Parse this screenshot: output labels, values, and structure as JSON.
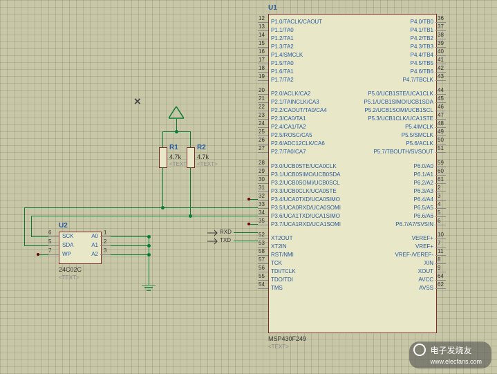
{
  "crosshair": "⨯",
  "power_marker": "△",
  "U1": {
    "ref": "U1",
    "part": "MSP430F249",
    "text_placeholder": "<TEXT>",
    "left_pins": [
      {
        "num": "12",
        "name": "P1.0/TACLK/CAOUT"
      },
      {
        "num": "13",
        "name": "P1.1/TA0"
      },
      {
        "num": "14",
        "name": "P1.2/TA1"
      },
      {
        "num": "15",
        "name": "P1.3/TA2"
      },
      {
        "num": "16",
        "name": "P1.4/SMCLK"
      },
      {
        "num": "17",
        "name": "P1.5/TA0"
      },
      {
        "num": "18",
        "name": "P1.6/TA1"
      },
      {
        "num": "19",
        "name": "P1.7/TA2"
      },
      {
        "gap": true
      },
      {
        "num": "20",
        "name": "P2.0/ACLK/CA2"
      },
      {
        "num": "21",
        "name": "P2.1/TAINCLK/CA3"
      },
      {
        "num": "22",
        "name": "P2.2/CAOUT/TA0/CA4"
      },
      {
        "num": "23",
        "name": "P2.3/CA0/TA1"
      },
      {
        "num": "24",
        "name": "P2.4/CA1/TA2"
      },
      {
        "num": "25",
        "name": "P2.5/ROSC/CA5"
      },
      {
        "num": "26",
        "name": "P2.6/ADC12CLK/CA6"
      },
      {
        "num": "27",
        "name": "P2.7/TA0/CA7"
      },
      {
        "gap": true
      },
      {
        "num": "28",
        "name": "P3.0/UCB0STE/UCA0CLK"
      },
      {
        "num": "29",
        "name": "P3.1/UCB0SIMO/UCB0SDA"
      },
      {
        "num": "30",
        "name": "P3.2/UCB0SOMI/UCB0SCL"
      },
      {
        "num": "31",
        "name": "P3.3/UCB0CLK/UCA0STE"
      },
      {
        "num": "32",
        "name": "P3.4/UCA0TXD/UCA0SIMO"
      },
      {
        "num": "33",
        "name": "P3.5/UCA0RXD/UCA0SOMI"
      },
      {
        "num": "34",
        "name": "P3.6/UCA1TXD/UCA1SIMO"
      },
      {
        "num": "35",
        "name": "P3.7/UCA1RXD/UCA1SOMI"
      },
      {
        "gap": true
      },
      {
        "num": "52",
        "name": "XT2OUT"
      },
      {
        "num": "53",
        "name": "XT2IN"
      },
      {
        "num": "58",
        "name": "RST/NMI"
      },
      {
        "num": "57",
        "name": "TCK"
      },
      {
        "num": "56",
        "name": "TDI/TCLK"
      },
      {
        "num": "55",
        "name": "TDO/TDI"
      },
      {
        "num": "54",
        "name": "TMS"
      }
    ],
    "right_pins": [
      {
        "num": "36",
        "name": "P4.0/TB0"
      },
      {
        "num": "37",
        "name": "P4.1/TB1"
      },
      {
        "num": "38",
        "name": "P4.2/TB2"
      },
      {
        "num": "39",
        "name": "P4.3/TB3"
      },
      {
        "num": "40",
        "name": "P4.4/TB4"
      },
      {
        "num": "41",
        "name": "P4.5/TB5"
      },
      {
        "num": "42",
        "name": "P4.6/TB6"
      },
      {
        "num": "43",
        "name": "P4.7/TBCLK"
      },
      {
        "gap": true
      },
      {
        "num": "44",
        "name": "P5.0/UCB1STE/UCA1CLK"
      },
      {
        "num": "45",
        "name": "P5.1/UCB1SIMO/UCB1SDA"
      },
      {
        "num": "46",
        "name": "P5.2/UCB1SOMI/UCB1SCL"
      },
      {
        "num": "47",
        "name": "P5.3/UCB1CLK/UCA1STE"
      },
      {
        "num": "48",
        "name": "P5.4/MCLK"
      },
      {
        "num": "49",
        "name": "P5.5/SMCLK"
      },
      {
        "num": "50",
        "name": "P5.6/ACLK"
      },
      {
        "num": "51",
        "name": "P5.7/TBOUTH/SVSOUT"
      },
      {
        "gap": true
      },
      {
        "num": "59",
        "name": "P6.0/A0"
      },
      {
        "num": "60",
        "name": "P6.1/A1"
      },
      {
        "num": "61",
        "name": "P6.2/A2"
      },
      {
        "num": "2",
        "name": "P6.3/A3"
      },
      {
        "num": "3",
        "name": "P6.4/A4"
      },
      {
        "num": "4",
        "name": "P6.5/A5"
      },
      {
        "num": "5",
        "name": "P6.6/A6"
      },
      {
        "num": "6",
        "name": "P6.7/A7/SVSIN"
      },
      {
        "gap": true
      },
      {
        "num": "10",
        "name": "VEREF+"
      },
      {
        "num": "7",
        "name": "VREF+"
      },
      {
        "num": "11",
        "name": "VREF-/VEREF-"
      },
      {
        "num": "8",
        "name": "XIN"
      },
      {
        "num": "9",
        "name": "XOUT"
      },
      {
        "num": "64",
        "name": "AVCC"
      },
      {
        "num": "62",
        "name": "AVSS"
      }
    ]
  },
  "U2": {
    "ref": "U2",
    "part": "24C02C",
    "text_placeholder": "<TEXT>",
    "left_pins": [
      {
        "num": "6",
        "name": "SCK"
      },
      {
        "num": "5",
        "name": "SDA"
      },
      {
        "num": "7",
        "name": "WP"
      }
    ],
    "right_pins": [
      {
        "num": "1",
        "name": "A0"
      },
      {
        "num": "2",
        "name": "A1"
      },
      {
        "num": "3",
        "name": "A2"
      }
    ]
  },
  "R1": {
    "ref": "R1",
    "value": "4.7k",
    "text_placeholder": "<TEXT>"
  },
  "R2": {
    "ref": "R2",
    "value": "4.7k",
    "text_placeholder": "<TEXT>"
  },
  "nets": {
    "rxd": "RXD",
    "txd": "TXD"
  },
  "watermark": {
    "brand": "电子发烧友",
    "url": "www.elecfans.com"
  }
}
